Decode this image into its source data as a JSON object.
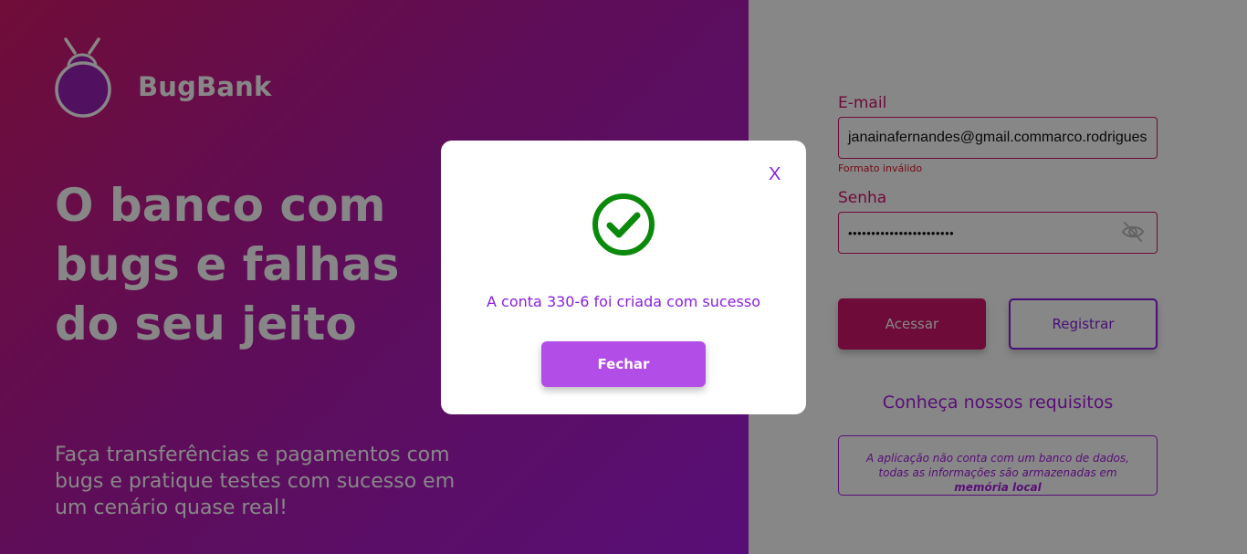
{
  "brand": {
    "name": "BugBank",
    "logo_icon": "bug-icon"
  },
  "hero": {
    "headline_1": "O banco com",
    "headline_2": "bugs e falhas",
    "headline_3": "do seu jeito",
    "sub_1": "Faça transferências e pagamentos com",
    "sub_2": "bugs e pratique testes com sucesso em",
    "sub_3": "um cenário quase real!"
  },
  "login": {
    "email_label": "E-mail",
    "email_value": "janainafernandes@gmail.commarco.rodrigues",
    "email_error": "Formato inválido",
    "password_label": "Senha",
    "password_value": "•••••••••••••••••••••••",
    "password_toggle_icon": "eye-slash-icon",
    "access_button": "Acessar",
    "register_button": "Registrar",
    "requirements_link": "Conheça nossos requisitos",
    "info_prefix": "A aplicação não conta com um banco de dados, todas as informações são armazenadas em",
    "info_bold": "memória local"
  },
  "modal": {
    "close_label": "X",
    "icon": "check-circle-icon",
    "message": "A conta 330-6 foi criada com sucesso",
    "button_label": "Fechar"
  },
  "colors": {
    "brand_pink": "#d0156c",
    "brand_purple": "#a71ce0",
    "success_green": "#0a8a0a",
    "modal_button": "#b34de8"
  }
}
